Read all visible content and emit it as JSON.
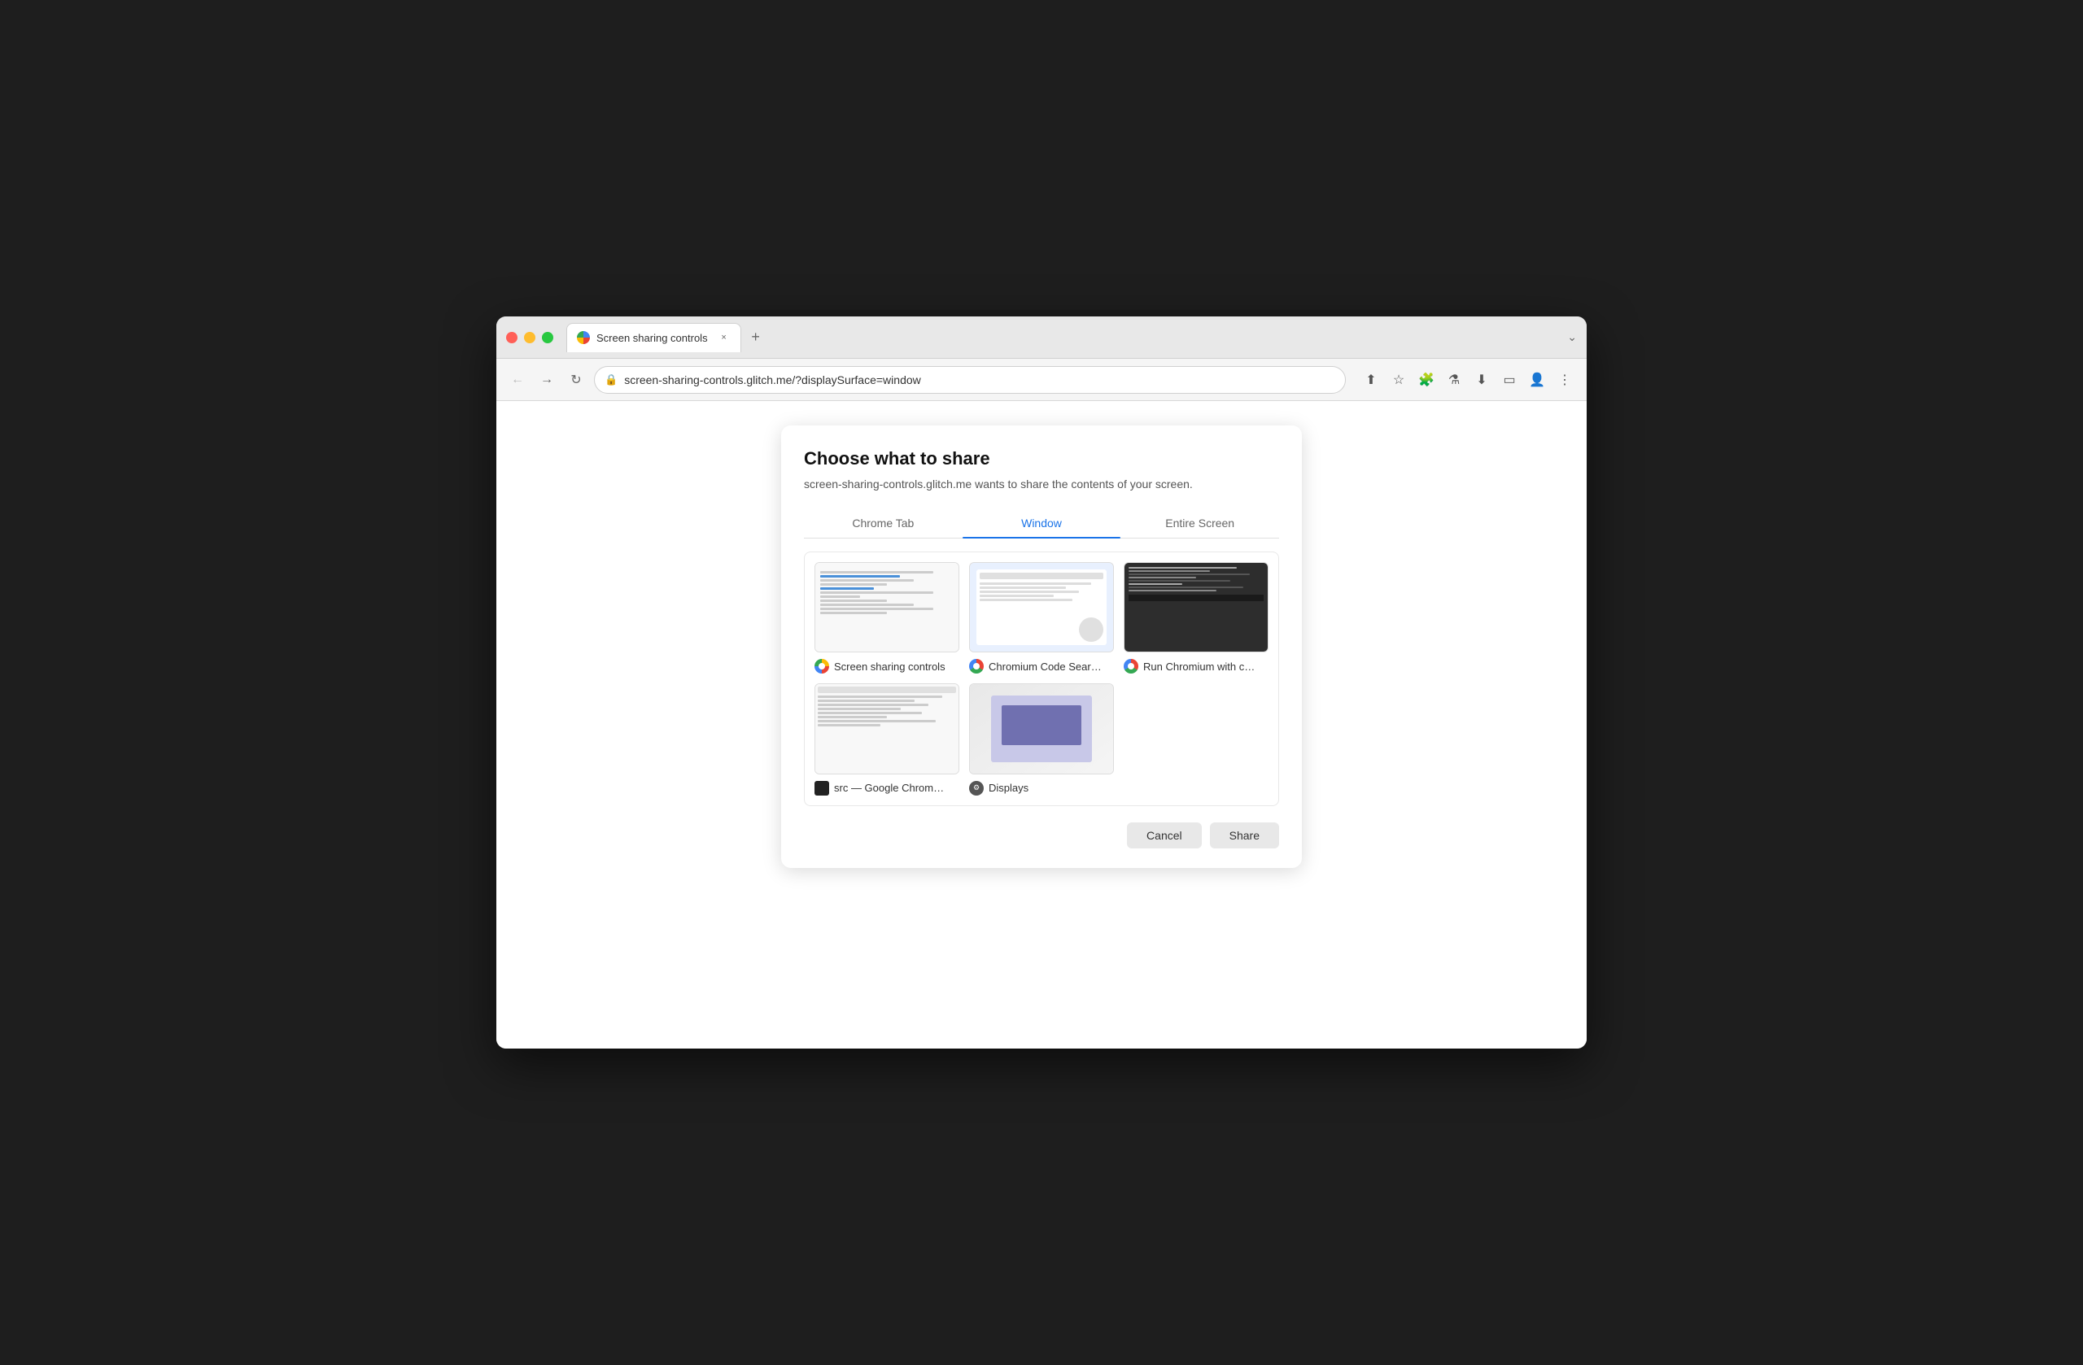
{
  "browser": {
    "tab_title": "Screen sharing controls",
    "url": "screen-sharing-controls.glitch.me/?displaySurface=window",
    "new_tab_label": "+",
    "tab_overflow": "⌄"
  },
  "nav": {
    "back": "←",
    "forward": "→",
    "reload": "↻"
  },
  "dialog": {
    "title": "Choose what to share",
    "subtitle": "screen-sharing-controls.glitch.me wants to share the contents of your screen.",
    "tabs": [
      {
        "id": "chrome-tab",
        "label": "Chrome Tab",
        "active": false
      },
      {
        "id": "window",
        "label": "Window",
        "active": true
      },
      {
        "id": "entire-screen",
        "label": "Entire Screen",
        "active": false
      }
    ],
    "windows": [
      {
        "id": "w1",
        "label": "Screen sharing controls",
        "icon_type": "chrome-yellow"
      },
      {
        "id": "w2",
        "label": "Chromium Code Searc...",
        "icon_type": "chrome"
      },
      {
        "id": "w3",
        "label": "Run Chromium with co...",
        "icon_type": "chrome"
      },
      {
        "id": "w4",
        "label": "src — Google Chrome...",
        "icon_type": "src"
      },
      {
        "id": "w5",
        "label": "Displays",
        "icon_type": "displays"
      }
    ],
    "cancel_label": "Cancel",
    "share_label": "Share"
  }
}
